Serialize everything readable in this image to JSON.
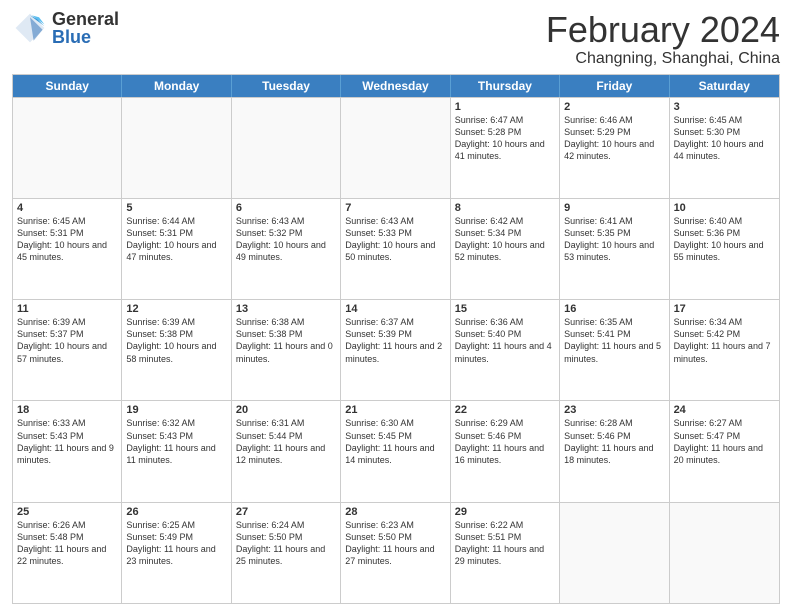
{
  "logo": {
    "general": "General",
    "blue": "Blue"
  },
  "title": "February 2024",
  "location": "Changning, Shanghai, China",
  "days_of_week": [
    "Sunday",
    "Monday",
    "Tuesday",
    "Wednesday",
    "Thursday",
    "Friday",
    "Saturday"
  ],
  "weeks": [
    [
      {
        "day": "",
        "empty": true
      },
      {
        "day": "",
        "empty": true
      },
      {
        "day": "",
        "empty": true
      },
      {
        "day": "",
        "empty": true
      },
      {
        "day": "1",
        "sunrise": "6:47 AM",
        "sunset": "5:28 PM",
        "daylight": "10 hours and 41 minutes."
      },
      {
        "day": "2",
        "sunrise": "6:46 AM",
        "sunset": "5:29 PM",
        "daylight": "10 hours and 42 minutes."
      },
      {
        "day": "3",
        "sunrise": "6:45 AM",
        "sunset": "5:30 PM",
        "daylight": "10 hours and 44 minutes."
      }
    ],
    [
      {
        "day": "4",
        "sunrise": "6:45 AM",
        "sunset": "5:31 PM",
        "daylight": "10 hours and 45 minutes."
      },
      {
        "day": "5",
        "sunrise": "6:44 AM",
        "sunset": "5:31 PM",
        "daylight": "10 hours and 47 minutes."
      },
      {
        "day": "6",
        "sunrise": "6:43 AM",
        "sunset": "5:32 PM",
        "daylight": "10 hours and 49 minutes."
      },
      {
        "day": "7",
        "sunrise": "6:43 AM",
        "sunset": "5:33 PM",
        "daylight": "10 hours and 50 minutes."
      },
      {
        "day": "8",
        "sunrise": "6:42 AM",
        "sunset": "5:34 PM",
        "daylight": "10 hours and 52 minutes."
      },
      {
        "day": "9",
        "sunrise": "6:41 AM",
        "sunset": "5:35 PM",
        "daylight": "10 hours and 53 minutes."
      },
      {
        "day": "10",
        "sunrise": "6:40 AM",
        "sunset": "5:36 PM",
        "daylight": "10 hours and 55 minutes."
      }
    ],
    [
      {
        "day": "11",
        "sunrise": "6:39 AM",
        "sunset": "5:37 PM",
        "daylight": "10 hours and 57 minutes."
      },
      {
        "day": "12",
        "sunrise": "6:39 AM",
        "sunset": "5:38 PM",
        "daylight": "10 hours and 58 minutes."
      },
      {
        "day": "13",
        "sunrise": "6:38 AM",
        "sunset": "5:38 PM",
        "daylight": "11 hours and 0 minutes."
      },
      {
        "day": "14",
        "sunrise": "6:37 AM",
        "sunset": "5:39 PM",
        "daylight": "11 hours and 2 minutes."
      },
      {
        "day": "15",
        "sunrise": "6:36 AM",
        "sunset": "5:40 PM",
        "daylight": "11 hours and 4 minutes."
      },
      {
        "day": "16",
        "sunrise": "6:35 AM",
        "sunset": "5:41 PM",
        "daylight": "11 hours and 5 minutes."
      },
      {
        "day": "17",
        "sunrise": "6:34 AM",
        "sunset": "5:42 PM",
        "daylight": "11 hours and 7 minutes."
      }
    ],
    [
      {
        "day": "18",
        "sunrise": "6:33 AM",
        "sunset": "5:43 PM",
        "daylight": "11 hours and 9 minutes."
      },
      {
        "day": "19",
        "sunrise": "6:32 AM",
        "sunset": "5:43 PM",
        "daylight": "11 hours and 11 minutes."
      },
      {
        "day": "20",
        "sunrise": "6:31 AM",
        "sunset": "5:44 PM",
        "daylight": "11 hours and 12 minutes."
      },
      {
        "day": "21",
        "sunrise": "6:30 AM",
        "sunset": "5:45 PM",
        "daylight": "11 hours and 14 minutes."
      },
      {
        "day": "22",
        "sunrise": "6:29 AM",
        "sunset": "5:46 PM",
        "daylight": "11 hours and 16 minutes."
      },
      {
        "day": "23",
        "sunrise": "6:28 AM",
        "sunset": "5:46 PM",
        "daylight": "11 hours and 18 minutes."
      },
      {
        "day": "24",
        "sunrise": "6:27 AM",
        "sunset": "5:47 PM",
        "daylight": "11 hours and 20 minutes."
      }
    ],
    [
      {
        "day": "25",
        "sunrise": "6:26 AM",
        "sunset": "5:48 PM",
        "daylight": "11 hours and 22 minutes."
      },
      {
        "day": "26",
        "sunrise": "6:25 AM",
        "sunset": "5:49 PM",
        "daylight": "11 hours and 23 minutes."
      },
      {
        "day": "27",
        "sunrise": "6:24 AM",
        "sunset": "5:50 PM",
        "daylight": "11 hours and 25 minutes."
      },
      {
        "day": "28",
        "sunrise": "6:23 AM",
        "sunset": "5:50 PM",
        "daylight": "11 hours and 27 minutes."
      },
      {
        "day": "29",
        "sunrise": "6:22 AM",
        "sunset": "5:51 PM",
        "daylight": "11 hours and 29 minutes."
      },
      {
        "day": "",
        "empty": true
      },
      {
        "day": "",
        "empty": true
      }
    ]
  ]
}
